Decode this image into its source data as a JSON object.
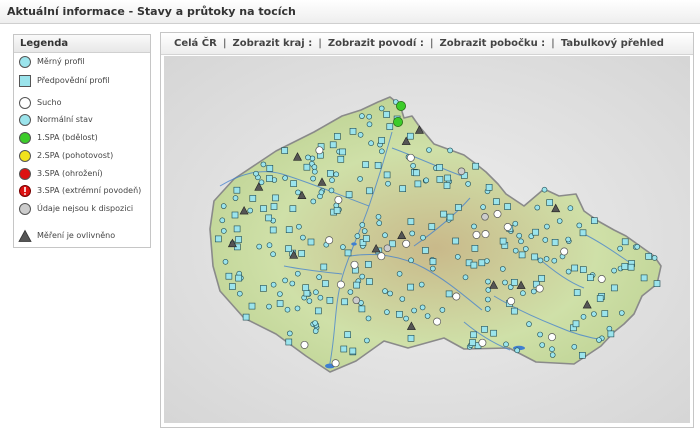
{
  "header": {
    "title": "Aktuální informace - Stavy a průtoky na tocích"
  },
  "legend": {
    "title": "Legenda",
    "items": [
      {
        "shape": "circle",
        "fill": "#9be4ec",
        "label": "Měrný profil"
      },
      {
        "shape": "square",
        "fill": "#9be4ec",
        "label": "Předpovědní profil"
      },
      {
        "shape": "circle",
        "fill": "#ffffff",
        "label": "Sucho"
      },
      {
        "shape": "circle",
        "fill": "#9be4ec",
        "label": "Normální stav"
      },
      {
        "shape": "circle",
        "fill": "#3ccc2a",
        "label": "1.SPA (bdělost)"
      },
      {
        "shape": "circle",
        "fill": "#f2e21c",
        "label": "2.SPA (pohotovost)"
      },
      {
        "shape": "circle",
        "fill": "#dd1111",
        "label": "3.SPA (ohrožení)"
      },
      {
        "shape": "exclaim",
        "fill": "#dd1111",
        "label": "3.SPA (extrémní povodeň)"
      },
      {
        "shape": "circle",
        "fill": "#cccccc",
        "label": "Údaje nejsou k dispozici"
      },
      {
        "shape": "triangle",
        "fill": "#555555",
        "label": "Měření je ovlivněno"
      }
    ]
  },
  "nav": {
    "separator": "|",
    "tabs": [
      "Celá ČR",
      "Zobrazit kraj :",
      "Zobrazit povodí :",
      "Zobrazit pobočku :",
      "Tabulkový přehled"
    ]
  },
  "map": {
    "colors": {
      "outside": "#e4e4e4",
      "land": "#cfe0a8",
      "hills": "#c9b98a",
      "rivers": "#3f7fd0",
      "border": "#8a8a8a"
    },
    "station_counts": {
      "measuring": 170,
      "forecast": 140,
      "dry": 22,
      "unavailable": 4
    },
    "alert_stations": [
      {
        "status": "1.SPA (bdělost)",
        "count": 2
      }
    ],
    "affected_count": 16
  }
}
